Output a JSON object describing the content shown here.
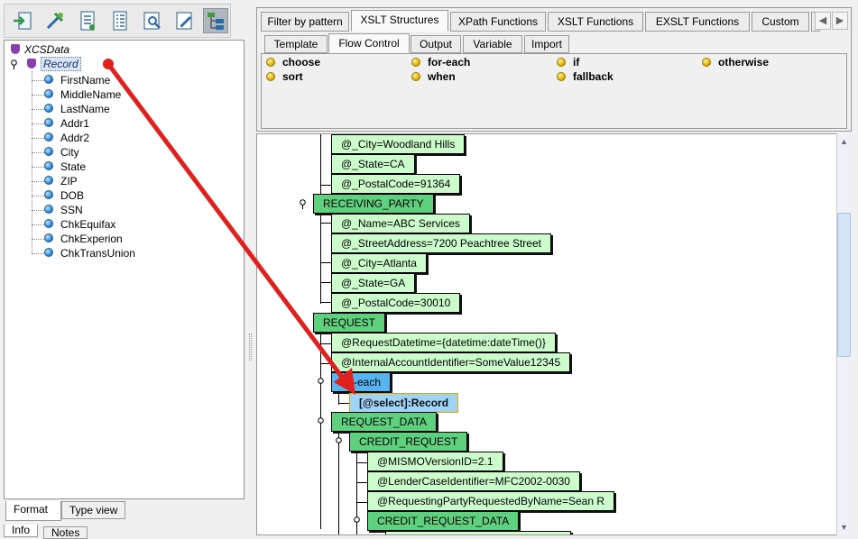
{
  "toolbar": {
    "buttons": [
      {
        "name": "import-icon"
      },
      {
        "name": "map-tool-icon"
      },
      {
        "name": "document-list-icon"
      },
      {
        "name": "tree-list-icon"
      },
      {
        "name": "preview-icon"
      },
      {
        "name": "edit-icon"
      },
      {
        "name": "schema-icon"
      }
    ]
  },
  "tree": {
    "root": "XCSData",
    "record": "Record",
    "fields": [
      "FirstName",
      "MiddleName",
      "LastName",
      "Addr1",
      "Addr2",
      "City",
      "State",
      "ZIP",
      "DOB",
      "SSN",
      "ChkEquifax",
      "ChkExperion",
      "ChkTransUnion"
    ]
  },
  "left_tabs": {
    "format": "Format",
    "type_view": "Type view",
    "info": "Info",
    "notes": "Notes"
  },
  "category_tabs": [
    "Filter by pattern",
    "XSLT Structures",
    "XPath Functions",
    "XSLT Functions",
    "EXSLT Functions",
    "Custom"
  ],
  "sub_tabs": [
    "Template",
    "Flow Control",
    "Output",
    "Variable",
    "Import"
  ],
  "functions": [
    "choose",
    "sort",
    "for-each",
    "when",
    "if",
    "fallback",
    "otherwise"
  ],
  "canvas": {
    "city1": "@_City=Woodland Hills",
    "state1": "@_State=CA",
    "postal1": "@_PostalCode=91364",
    "receiving": "RECEIVING_PARTY",
    "name": "@_Name=ABC Services",
    "street": "@_StreetAddress=7200 Peachtree Street",
    "city2": "@_City=Atlanta",
    "state2": "@_State=GA",
    "postal2": "@_PostalCode=30010",
    "request": "REQUEST",
    "datetime": "@RequestDatetime={datetime:dateTime()}",
    "internal": "@InternalAccountIdentifier=SomeValue12345",
    "foreach": "for-each",
    "select": "[@select]:Record",
    "request_data": "REQUEST_DATA",
    "credit_request": "CREDIT_REQUEST",
    "mismo": "@MISMOVersionID=2.1",
    "lender": "@LenderCaseIdentifier=MFC2002-0030",
    "requesting": "@RequestingPartyRequestedByName=Sean R",
    "credit_request_data": "CREDIT_REQUEST_DATA"
  },
  "colors": {
    "node_light": "#ccfccc",
    "node_strong": "#5ed07e",
    "node_blue": "#56b4f0",
    "arrow": "#e0201c"
  }
}
